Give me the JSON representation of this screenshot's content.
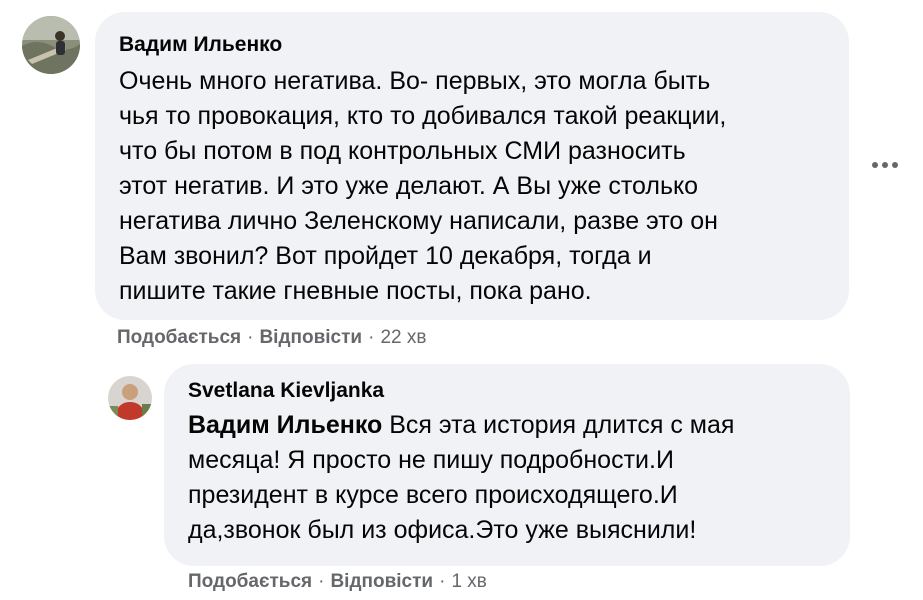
{
  "comment1": {
    "author": "Вадим Ильенко",
    "lines": [
      "Очень много негатива. Во- первых, это могла быть",
      "чья то провокация, кто то добивался такой реакции,",
      "что бы потом в под контрольных СМИ разносить",
      "этот негатив. И это уже делают. А Вы уже столько",
      "негатива лично Зеленскому написали, разве это он",
      "Вам звонил? Вот пройдет 10 декабря, тогда и",
      "пишите такие гневные посты, пока рано."
    ],
    "like_label": "Подобається",
    "reply_label": "Відповісти",
    "time": "22 хв",
    "separator": "·",
    "more_icon": "more-horizontal-icon"
  },
  "comment2": {
    "author": "Svetlana Kievljanka",
    "mention": "Вадим Ильенко",
    "first_line_rest": " Вся эта история длится с мая",
    "lines": [
      "месяца! Я просто не пишу подробности.И",
      "президент в курсе всего происходящего.И",
      "да,звонок был из офиса.Это уже выяснили!"
    ],
    "like_label": "Подобається",
    "reply_label": "Відповісти",
    "time": "1 хв",
    "separator": "·"
  },
  "colors": {
    "bubble": "#f0f2f5",
    "meta_text": "#65676b",
    "text": "#050505"
  }
}
